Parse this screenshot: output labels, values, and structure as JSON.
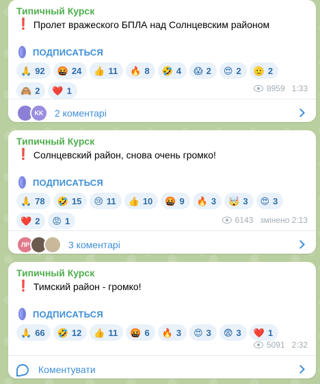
{
  "messages": [
    {
      "channel": "Типичный Курск",
      "exclamation": "❗",
      "text": "Пролет вражеского БПЛА над Солнцевским районом",
      "subscribe": "ПОДПИСАТЬСЯ",
      "reactions": [
        {
          "emoji": "🙏",
          "count": "92"
        },
        {
          "emoji": "🤬",
          "count": "24"
        },
        {
          "emoji": "👍",
          "count": "11"
        },
        {
          "emoji": "🔥",
          "count": "8"
        },
        {
          "emoji": "🤣",
          "count": "4"
        },
        {
          "emoji": "😱",
          "count": "2"
        },
        {
          "emoji": "😍",
          "count": "2"
        },
        {
          "emoji": "🫡",
          "count": "2"
        },
        {
          "emoji": "🙈",
          "count": "2"
        },
        {
          "emoji": "❤️",
          "count": "1"
        }
      ],
      "views": "8959",
      "time": "1:33",
      "comments": "2 коментарі",
      "avatars": [
        {
          "label": "",
          "color": "#8b7fd6"
        },
        {
          "label": "KK",
          "color": "#9a8ee0"
        }
      ]
    },
    {
      "channel": "Типичный Курск",
      "exclamation": "❗",
      "text": "Солнцевский район, снова очень громко!",
      "subscribe": "ПОДПИСАТЬСЯ",
      "reactions": [
        {
          "emoji": "🙏",
          "count": "78"
        },
        {
          "emoji": "🤣",
          "count": "15"
        },
        {
          "emoji": "😢",
          "count": "11"
        },
        {
          "emoji": "👍",
          "count": "10"
        },
        {
          "emoji": "🤬",
          "count": "9"
        },
        {
          "emoji": "🔥",
          "count": "3"
        },
        {
          "emoji": "🤯",
          "count": "3"
        },
        {
          "emoji": "😍",
          "count": "3"
        },
        {
          "emoji": "❤️",
          "count": "2"
        },
        {
          "emoji": "😡",
          "count": "1"
        }
      ],
      "views": "6143",
      "time": "змінено 2:13",
      "comments": "3 коментарі",
      "avatars": [
        {
          "label": "ЛР",
          "color": "#e07a8a"
        },
        {
          "label": "",
          "color": "#6b5a4e"
        },
        {
          "label": "",
          "color": "#c9b89a"
        }
      ]
    },
    {
      "channel": "Типичный Курск",
      "exclamation": "❗",
      "text": "Тимский район - громко!",
      "subscribe": "ПОДПИСАТЬСЯ",
      "reactions": [
        {
          "emoji": "🙏",
          "count": "66"
        },
        {
          "emoji": "🤣",
          "count": "12"
        },
        {
          "emoji": "👍",
          "count": "11"
        },
        {
          "emoji": "🤬",
          "count": "6"
        },
        {
          "emoji": "🔥",
          "count": "3"
        },
        {
          "emoji": "😍",
          "count": "3"
        },
        {
          "emoji": "😨",
          "count": "3"
        },
        {
          "emoji": "❤️",
          "count": "1"
        }
      ],
      "views": "5091",
      "time": "2:32",
      "comments": "Коментувати"
    }
  ],
  "colors": {
    "channel": "#4fae4e",
    "accent": "#3f8fd6",
    "reaction_bg": "#e9f1fa",
    "meta": "#a2acb4",
    "background": "#b9cfa0"
  }
}
